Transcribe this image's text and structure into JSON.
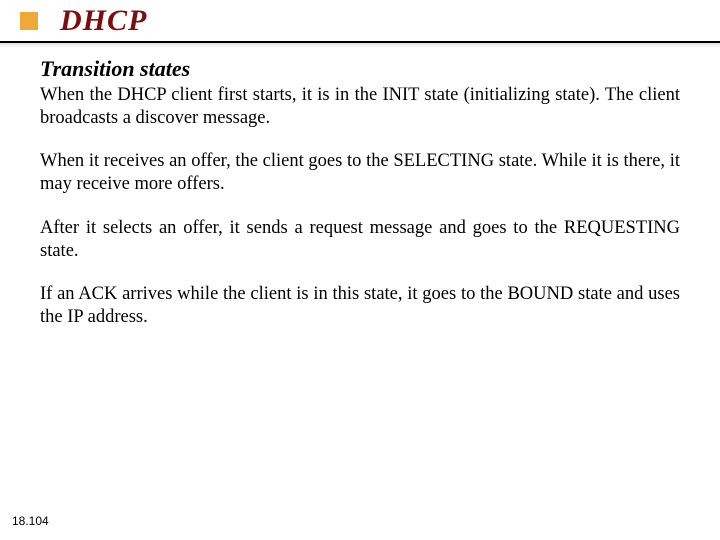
{
  "header": {
    "title": "DHCP"
  },
  "subheading": "Transition states",
  "paragraphs": [
    "When the DHCP client first starts, it is in the INIT state (initializing state). The client broadcasts a discover message.",
    "When it receives an offer, the client goes to the SELECTING state. While it is there, it may receive more offers.",
    "After it selects an offer, it sends a request message and goes to the REQUESTING state.",
    "If an ACK arrives while the client is in this state, it goes to the BOUND state and uses the IP address."
  ],
  "page_number": "18.104"
}
